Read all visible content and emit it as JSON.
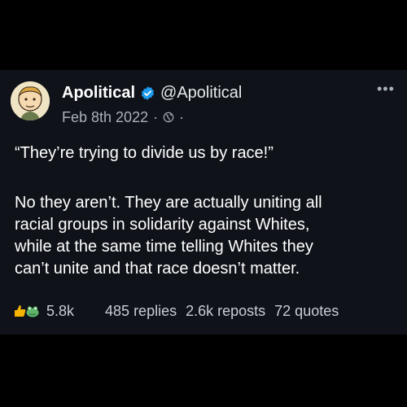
{
  "post": {
    "author_name": "Apolitical",
    "handle": "@Apolitical",
    "date": "Feb 8th 2022",
    "meta_sep_1": "·",
    "meta_sep_2": "·",
    "quote_line": "“They’re trying to divide us by race!”",
    "body_lines": [
      "No they aren’t. They are actually uniting all",
      "racial groups in solidarity against Whites,",
      "while at the same time telling Whites they",
      "can’t unite and that race doesn’t matter."
    ],
    "more_label": "•••"
  },
  "stats": {
    "likes": "5.8k",
    "replies": "485 replies",
    "reposts": "2.6k reposts",
    "quotes": "72 quotes"
  },
  "icons": {
    "verified": "verified-badge-icon",
    "globe": "globe-icon",
    "more": "more-options-icon",
    "reactions": [
      "thumbs-up-icon",
      "frog-icon"
    ]
  },
  "colors": {
    "background": "#000000",
    "card": "#0f1319",
    "verified_blue": "#1d9bf0",
    "text": "#ffffff",
    "muted": "#a9b0b7"
  }
}
